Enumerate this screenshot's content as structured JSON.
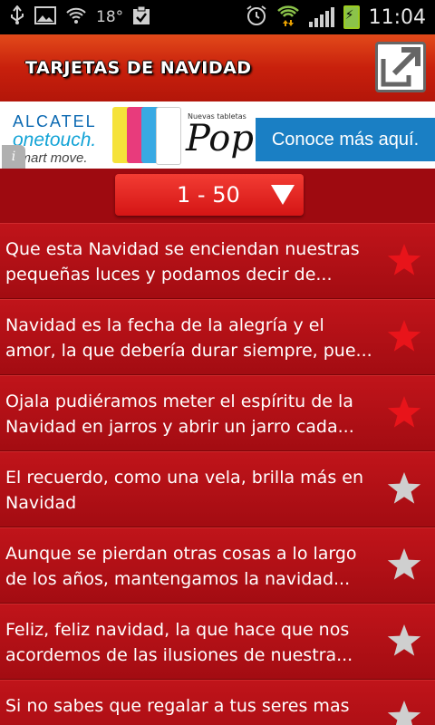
{
  "status_bar": {
    "temperature": "18°",
    "time": "11:04",
    "icons": [
      "usb-icon",
      "image-icon",
      "wifi-icon",
      "clipboard-check-icon",
      "alarm-icon",
      "wifi-transfer-icon",
      "signal-icon",
      "battery-charging-icon"
    ]
  },
  "header": {
    "title": "TARJETAS DE NAVIDAD",
    "share_icon": "share-export-icon"
  },
  "ad": {
    "brand_line1": "ALCATEL",
    "brand_line2": "onetouch.",
    "brand_line3": "smart move.",
    "small_text": "Nuevas tabletas",
    "product": "Pop",
    "cta": "Conoce más aquí.",
    "info_icon": "i"
  },
  "selector": {
    "range": "1 - 50",
    "icon": "dropdown-triangle-icon"
  },
  "items": [
    {
      "text": "Que esta Navidad se enciendan nuestras pequeñas luces y podamos decir de...",
      "favorite": true
    },
    {
      "text": "Navidad es la fecha de la alegría y el amor, la que debería durar siempre, pue...",
      "favorite": true
    },
    {
      "text": "Ojala pudiéramos meter el espíritu de la Navidad en jarros y abrir un jarro cada...",
      "favorite": true
    },
    {
      "text": "El recuerdo, como una vela, brilla más en Navidad",
      "favorite": false
    },
    {
      "text": "Aunque se pierdan otras cosas a lo largo de los años, mantengamos la navidad...",
      "favorite": false
    },
    {
      "text": "Feliz, feliz navidad, la que hace que nos acordemos de las ilusiones de nuestra...",
      "favorite": false
    },
    {
      "text": "Si no sabes que regalar a tus seres mas",
      "favorite": false
    }
  ],
  "colors": {
    "favorite_on": "#e8141a",
    "favorite_off": "#cfcfcf",
    "header": "#c8200c",
    "background": "#9e0a10"
  }
}
